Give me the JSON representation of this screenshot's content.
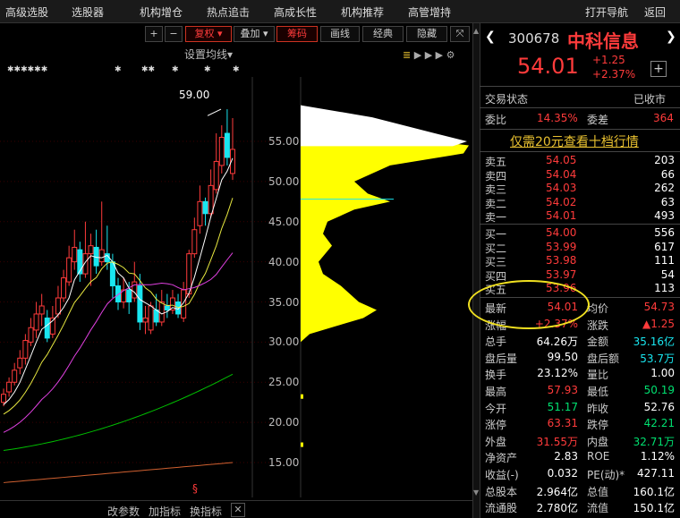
{
  "menu": [
    "高级选股",
    "选股器",
    "机构增仓",
    "热点追击",
    "高成长性",
    "机构推荐",
    "高管增持"
  ],
  "menu_right": [
    "打开导航",
    "返回"
  ],
  "toolbar": {
    "plus": "+",
    "minus": "−",
    "fuquan": "复权",
    "fuquan_arrow": "▾",
    "diejia": "叠加",
    "diejia_arrow": "▾",
    "chouma": "筹码",
    "huaxian": "画线",
    "jingdian": "经典",
    "yincang": "隐藏",
    "settings": "设置均线",
    "settings_arrow": "▾"
  },
  "chart": {
    "price_labels": [
      "55.00",
      "50.00",
      "45.00",
      "40.00",
      "35.00",
      "30.00",
      "25.00",
      "20.00",
      "15.00"
    ],
    "high_label": "59.00",
    "markers": [
      "✱✱✱✱✱✱",
      "✱",
      "✱✱",
      "✱",
      "✱",
      "✱"
    ],
    "bottom_buttons": [
      "改参数",
      "加指标",
      "换指标"
    ],
    "close_x": "✕",
    "s_marker": "§",
    "colors": {
      "up": "#ff3b3b",
      "down": "#19e6f0",
      "ma5": "#ffffff",
      "ma10": "#e8e840",
      "ma20": "#e040e0",
      "ma60": "#00c000",
      "ma120": "#d06030",
      "chip_main": "#ffff00",
      "chip_top": "#ffffff",
      "cost_line": "#19e6f0"
    }
  },
  "candles": [
    {
      "o": 22.5,
      "c": 23.5,
      "h": 24.2,
      "l": 22.0
    },
    {
      "o": 23.8,
      "c": 25.0,
      "h": 25.6,
      "l": 23.2
    },
    {
      "o": 25.0,
      "c": 26.5,
      "h": 27.4,
      "l": 24.6
    },
    {
      "o": 26.8,
      "c": 28.0,
      "h": 29.0,
      "l": 26.0
    },
    {
      "o": 28.0,
      "c": 30.2,
      "h": 31.0,
      "l": 27.2
    },
    {
      "o": 30.0,
      "c": 31.8,
      "h": 33.0,
      "l": 29.5
    },
    {
      "o": 31.5,
      "c": 33.5,
      "h": 35.0,
      "l": 30.5
    },
    {
      "o": 33.5,
      "c": 34.5,
      "h": 36.0,
      "l": 32.0
    },
    {
      "o": 33.0,
      "c": 30.5,
      "h": 34.0,
      "l": 30.0
    },
    {
      "o": 31.0,
      "c": 33.0,
      "h": 34.5,
      "l": 30.5
    },
    {
      "o": 33.5,
      "c": 35.5,
      "h": 37.0,
      "l": 33.0
    },
    {
      "o": 35.5,
      "c": 38.0,
      "h": 39.0,
      "l": 35.0
    },
    {
      "o": 37.5,
      "c": 40.5,
      "h": 42.0,
      "l": 37.0
    },
    {
      "o": 40.0,
      "c": 41.8,
      "h": 44.0,
      "l": 39.0
    },
    {
      "o": 41.5,
      "c": 38.5,
      "h": 42.5,
      "l": 37.5
    },
    {
      "o": 38.5,
      "c": 41.0,
      "h": 45.0,
      "l": 38.0
    },
    {
      "o": 41.0,
      "c": 42.0,
      "h": 43.5,
      "l": 37.0
    },
    {
      "o": 41.8,
      "c": 39.5,
      "h": 44.0,
      "l": 38.5
    },
    {
      "o": 40.0,
      "c": 41.5,
      "h": 47.5,
      "l": 39.5
    },
    {
      "o": 41.0,
      "c": 40.0,
      "h": 44.5,
      "l": 39.0
    },
    {
      "o": 40.0,
      "c": 37.0,
      "h": 41.0,
      "l": 35.5
    },
    {
      "o": 37.0,
      "c": 35.0,
      "h": 38.0,
      "l": 34.0
    },
    {
      "o": 35.0,
      "c": 36.5,
      "h": 38.0,
      "l": 34.2
    },
    {
      "o": 36.5,
      "c": 35.0,
      "h": 37.5,
      "l": 33.5
    },
    {
      "o": 35.5,
      "c": 37.5,
      "h": 40.0,
      "l": 35.0
    },
    {
      "o": 37.0,
      "c": 32.5,
      "h": 38.5,
      "l": 31.5
    },
    {
      "o": 32.5,
      "c": 33.0,
      "h": 34.5,
      "l": 31.0
    },
    {
      "o": 31.5,
      "c": 34.5,
      "h": 35.0,
      "l": 31.0
    },
    {
      "o": 34.0,
      "c": 32.5,
      "h": 36.0,
      "l": 32.0
    },
    {
      "o": 32.5,
      "c": 35.0,
      "h": 36.5,
      "l": 32.0
    },
    {
      "o": 34.5,
      "c": 34.0,
      "h": 36.0,
      "l": 33.0
    },
    {
      "o": 34.0,
      "c": 35.5,
      "h": 36.5,
      "l": 33.5
    },
    {
      "o": 35.0,
      "c": 33.5,
      "h": 36.0,
      "l": 33.0
    },
    {
      "o": 33.0,
      "c": 36.5,
      "h": 37.5,
      "l": 32.5
    },
    {
      "o": 36.0,
      "c": 41.0,
      "h": 41.5,
      "l": 35.5
    },
    {
      "o": 41.0,
      "c": 44.0,
      "h": 45.5,
      "l": 40.5
    },
    {
      "o": 44.5,
      "c": 47.5,
      "h": 49.5,
      "l": 43.5
    },
    {
      "o": 47.5,
      "c": 46.0,
      "h": 48.0,
      "l": 44.5
    },
    {
      "o": 46.0,
      "c": 49.5,
      "h": 51.5,
      "l": 45.5
    },
    {
      "o": 49.0,
      "c": 52.5,
      "h": 56.0,
      "l": 48.5
    },
    {
      "o": 52.0,
      "c": 55.5,
      "h": 57.0,
      "l": 51.0
    },
    {
      "o": 56.0,
      "c": 53.0,
      "h": 59.0,
      "l": 52.0
    },
    {
      "o": 51.0,
      "c": 54.0,
      "h": 57.9,
      "l": 50.2
    }
  ],
  "stock": {
    "code": "300678",
    "name": "中科信息",
    "price": "54.01",
    "change": "+1.25",
    "change_pct": "+2.37%",
    "plus_btn": "+",
    "nav_left": "❮",
    "nav_right": "❯"
  },
  "status": {
    "label": "交易状态",
    "value": "已收市"
  },
  "weibi": {
    "label": "委比",
    "value": "14.35%",
    "label2": "委差",
    "value2": "364"
  },
  "promo": "仅需20元查看十档行情",
  "asks": [
    {
      "label": "卖五",
      "price": "54.05",
      "vol": "203"
    },
    {
      "label": "卖四",
      "price": "54.04",
      "vol": "66"
    },
    {
      "label": "卖三",
      "price": "54.03",
      "vol": "262"
    },
    {
      "label": "卖二",
      "price": "54.02",
      "vol": "63"
    },
    {
      "label": "卖一",
      "price": "54.01",
      "vol": "493"
    }
  ],
  "bids": [
    {
      "label": "买一",
      "price": "54.00",
      "vol": "556"
    },
    {
      "label": "买二",
      "price": "53.99",
      "vol": "617"
    },
    {
      "label": "买三",
      "price": "53.98",
      "vol": "111"
    },
    {
      "label": "买四",
      "price": "53.97",
      "vol": "54"
    },
    {
      "label": "买五",
      "price": "53.96",
      "vol": "113"
    }
  ],
  "quote": [
    {
      "l1": "最新",
      "v1": "54.01",
      "c1": "red",
      "l2": "均价",
      "v2": "54.73",
      "c2": "red"
    },
    {
      "l1": "涨幅",
      "v1": "+2.37%",
      "c1": "red",
      "l2": "涨跌",
      "v2": "▲1.25",
      "c2": "red"
    },
    {
      "l1": "总手",
      "v1": "64.26万",
      "c1": "wht",
      "l2": "金额",
      "v2": "35.16亿",
      "c2": "cy"
    },
    {
      "l1": "盘后量",
      "v1": "99.50",
      "c1": "wht",
      "l2": "盘后额",
      "v2": "53.7万",
      "c2": "cy"
    },
    {
      "l1": "换手",
      "v1": "23.12%",
      "c1": "wht",
      "l2": "量比",
      "v2": "1.00",
      "c2": "wht"
    },
    {
      "l1": "最高",
      "v1": "57.93",
      "c1": "red",
      "l2": "最低",
      "v2": "50.19",
      "c2": "grn"
    },
    {
      "l1": "今开",
      "v1": "51.17",
      "c1": "grn",
      "l2": "昨收",
      "v2": "52.76",
      "c2": "wht"
    },
    {
      "l1": "涨停",
      "v1": "63.31",
      "c1": "red",
      "l2": "跌停",
      "v2": "42.21",
      "c2": "grn"
    },
    {
      "l1": "外盘",
      "v1": "31.55万",
      "c1": "red",
      "l2": "内盘",
      "v2": "32.71万",
      "c2": "grn"
    },
    {
      "l1": "净资产",
      "v1": "2.83",
      "c1": "wht",
      "l2": "ROE",
      "v2": "1.12%",
      "c2": "wht"
    },
    {
      "l1": "收益(-)",
      "v1": "0.032",
      "c1": "wht",
      "l2": "PE(动)*",
      "v2": "427.11",
      "c2": "wht"
    },
    {
      "l1": "总股本",
      "v1": "2.964亿",
      "c1": "wht",
      "l2": "总值",
      "v2": "160.1亿",
      "c2": "wht"
    },
    {
      "l1": "流通股",
      "v1": "2.780亿",
      "c1": "wht",
      "l2": "流值",
      "v2": "150.1亿",
      "c2": "wht"
    }
  ]
}
